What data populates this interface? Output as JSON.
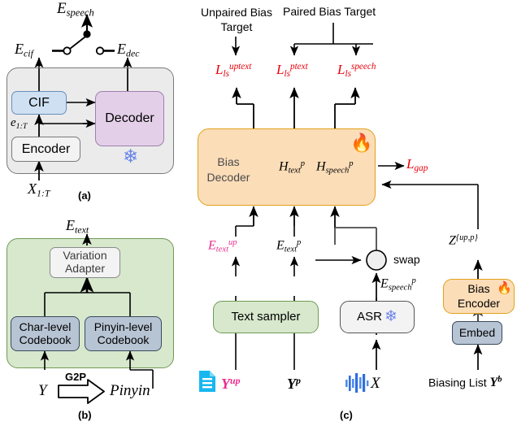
{
  "figure": {
    "panels": [
      {
        "id": "a",
        "caption": "(a)"
      },
      {
        "id": "b",
        "caption": "(b)"
      },
      {
        "id": "c",
        "caption": "(c)"
      }
    ]
  },
  "colors": {
    "panel_a_bg": "#ebebeb",
    "panel_b_bg": "#d7e8cd",
    "cif_box": "#cfe0f3",
    "decoder_box": "#e3d0e8",
    "encoder_box": "#f2f2f2",
    "codebook_box": "#b7c4d4",
    "bias_module": "#fbddb8",
    "bias_module_border": "#e0a21a",
    "text_sampler": "#d7e8cd",
    "asr_box": "#f2f2f2",
    "embed_box": "#b7c4d4",
    "loss_red": "#e8000b",
    "unpaired_pink": "#ec2a8c",
    "snowflake_blue": "#6b84ea",
    "doc_icon_blue": "#18b7f0",
    "wave_icon_blue": "#2f6fe0"
  },
  "panel_a": {
    "caption": "(a)",
    "output_label": {
      "base": "E",
      "sub": "speech"
    },
    "switch_left_label": {
      "base": "E",
      "sub": "cif"
    },
    "switch_right_label": {
      "base": "E",
      "sub": "dec"
    },
    "cif_label": "CIF",
    "decoder_label": "Decoder",
    "encoder_label": "Encoder",
    "hidden_label": {
      "base": "e",
      "sub": "1:T"
    },
    "input_label": {
      "base": "X",
      "sub": "1:T"
    },
    "frozen_icon": "snowflake-icon"
  },
  "panel_b": {
    "caption": "(b)",
    "output_label": {
      "base": "E",
      "sub": "text"
    },
    "variation_adapter_label": "Variation\nAdapter",
    "variation_adapter_line1": "Variation",
    "variation_adapter_line2": "Adapter",
    "char_codebook_line1": "Char-level",
    "char_codebook_line2": "Codebook",
    "pinyin_codebook_line1": "Pinyin-level",
    "pinyin_codebook_line2": "Codebook",
    "input_label": "Y",
    "g2p_label": "G2P",
    "pinyin_label": "Pinyin"
  },
  "panel_c": {
    "caption": "(c)",
    "unpaired_target_line1": "Unpaired Bias",
    "unpaired_target_line2": "Target",
    "paired_target": "Paired Bias Target",
    "losses": [
      {
        "base": "L",
        "sub": "ls",
        "sup": "uptext"
      },
      {
        "base": "L",
        "sub": "ls",
        "sup": "ptext"
      },
      {
        "base": "L",
        "sub": "ls",
        "sup": "speech"
      }
    ],
    "gap_loss": {
      "base": "L",
      "sub": "gap"
    },
    "bias_decoder_line1": "Bias",
    "bias_decoder_line2": "Decoder",
    "h_text": {
      "base": "H",
      "sub": "text",
      "sup": "p"
    },
    "h_speech": {
      "base": "H",
      "sub": "speech",
      "sup": "p"
    },
    "e_text_up": {
      "base": "E",
      "sub": "text",
      "sup": "up"
    },
    "e_text_p": {
      "base": "E",
      "sub": "text",
      "sup": "p"
    },
    "e_speech_p": {
      "base": "E",
      "sub": "speech",
      "sup": "p"
    },
    "swap_label": "swap",
    "text_sampler_label": "Text sampler",
    "asr_label": "ASR",
    "embed_label": "Embed",
    "bias_encoder_line1": "Bias",
    "bias_encoder_line2": "Encoder",
    "z_label": {
      "base": "Z",
      "sup": "{up,p}"
    },
    "y_up": {
      "base": "Y",
      "sup": "up"
    },
    "y_p": {
      "base": "Y",
      "sup": "p"
    },
    "x_input": "X",
    "biasing_list_text": "Biasing List",
    "biasing_list_sym": {
      "base": "Y",
      "sup": "b"
    },
    "trainable_icon": "flame-icon",
    "frozen_icon": "snowflake-icon",
    "doc_icon": "document-icon",
    "audio_icon": "waveform-icon"
  }
}
